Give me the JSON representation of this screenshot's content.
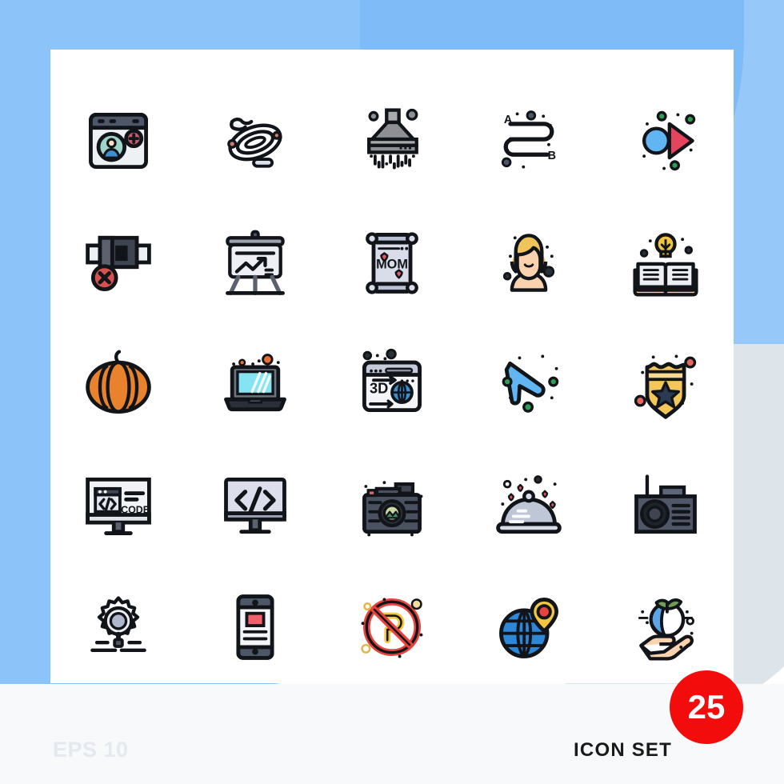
{
  "meta": {
    "format_label": "EPS 10",
    "set_label": "ICON SET",
    "count_badge": "25"
  },
  "colors": {
    "background_blue": "#8CC3F9",
    "background_blue_light": "#96C8FA",
    "background_gray": "#DDE4EA",
    "card_white": "#FFFFFF",
    "badge_red": "#F30C0C",
    "outline": "#111418",
    "eps_text": "#E3E9EE",
    "iconset_text": "#1A1A1A"
  },
  "grid": {
    "columns": 5,
    "rows": 5,
    "total": 25
  },
  "icons": [
    {
      "row": 1,
      "col": 1,
      "name": "add-user-browser-icon",
      "label": "Add user browser window"
    },
    {
      "row": 1,
      "col": 2,
      "name": "garden-hose-icon",
      "label": "Garden hose"
    },
    {
      "row": 1,
      "col": 3,
      "name": "shower-head-icon",
      "label": "Shower head"
    },
    {
      "row": 1,
      "col": 4,
      "name": "route-a-to-b-icon",
      "label": "Route from A to B"
    },
    {
      "row": 1,
      "col": 5,
      "name": "media-play-icon",
      "label": "Play media"
    },
    {
      "row": 2,
      "col": 1,
      "name": "no-camera-icon",
      "label": "Camera disabled"
    },
    {
      "row": 2,
      "col": 2,
      "name": "presentation-chart-icon",
      "label": "Presentation board chart"
    },
    {
      "row": 2,
      "col": 3,
      "name": "mom-scroll-icon",
      "label": "Mom scroll certificate"
    },
    {
      "row": 2,
      "col": 4,
      "name": "woman-avatar-icon",
      "label": "Woman avatar"
    },
    {
      "row": 2,
      "col": 5,
      "name": "book-idea-icon",
      "label": "Open book with idea bulb"
    },
    {
      "row": 3,
      "col": 1,
      "name": "pumpkin-icon",
      "label": "Pumpkin"
    },
    {
      "row": 3,
      "col": 2,
      "name": "laptop-icon",
      "label": "Laptop"
    },
    {
      "row": 3,
      "col": 3,
      "name": "3d-web-browser-icon",
      "label": "3D web browser"
    },
    {
      "row": 3,
      "col": 4,
      "name": "cursor-arrow-icon",
      "label": "Cursor arrow"
    },
    {
      "row": 3,
      "col": 5,
      "name": "police-badge-icon",
      "label": "Police badge"
    },
    {
      "row": 4,
      "col": 1,
      "name": "code-monitor-icon",
      "label": "Code monitor"
    },
    {
      "row": 4,
      "col": 2,
      "name": "code-screen-icon",
      "label": "Code screen"
    },
    {
      "row": 4,
      "col": 3,
      "name": "photo-camera-icon",
      "label": "Photo camera"
    },
    {
      "row": 4,
      "col": 4,
      "name": "food-cloche-icon",
      "label": "Food cloche tray"
    },
    {
      "row": 4,
      "col": 5,
      "name": "radio-icon",
      "label": "Radio"
    },
    {
      "row": 5,
      "col": 1,
      "name": "search-settings-icon",
      "label": "Search settings gear"
    },
    {
      "row": 5,
      "col": 2,
      "name": "mobile-content-icon",
      "label": "Mobile content"
    },
    {
      "row": 5,
      "col": 3,
      "name": "no-parking-icon",
      "label": "No parking"
    },
    {
      "row": 5,
      "col": 4,
      "name": "globe-location-icon",
      "label": "Globe location pin"
    },
    {
      "row": 5,
      "col": 5,
      "name": "eco-hand-plant-icon",
      "label": "Hand holding eco plant"
    }
  ],
  "icon_text": {
    "route_a": "A",
    "route_b": "B",
    "scroll_word": "MOM",
    "browser_3d": "3D",
    "monitor_code": "CODE"
  }
}
